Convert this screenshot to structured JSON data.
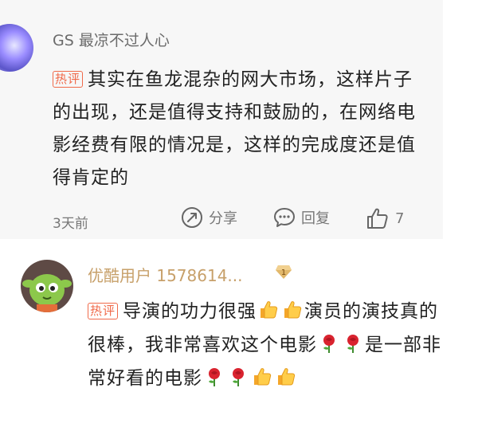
{
  "comment1": {
    "username": "GS 最凉不过人心",
    "hot_tag": "热评",
    "text": "其实在鱼龙混杂的网大市场，这样片子的出现，还是值得支持和鼓励的，在网络电影经费有限的情况是，这样的完成度还是值得肯定的",
    "time": "3天前",
    "share_label": "分享",
    "reply_label": "回复",
    "like_count": "7"
  },
  "comment2": {
    "username": "优酷用户 1578614...",
    "vip_level": "1",
    "hot_tag": "热评",
    "text_part1": "导演的功力很强",
    "text_part2": "演员的演技真的很棒，我非常喜欢这个电影",
    "text_part3": "是一部非常好看的电影"
  },
  "colors": {
    "hot_tag": "#f06a4a",
    "vip_name": "#c7a06a",
    "meta": "#777777"
  }
}
